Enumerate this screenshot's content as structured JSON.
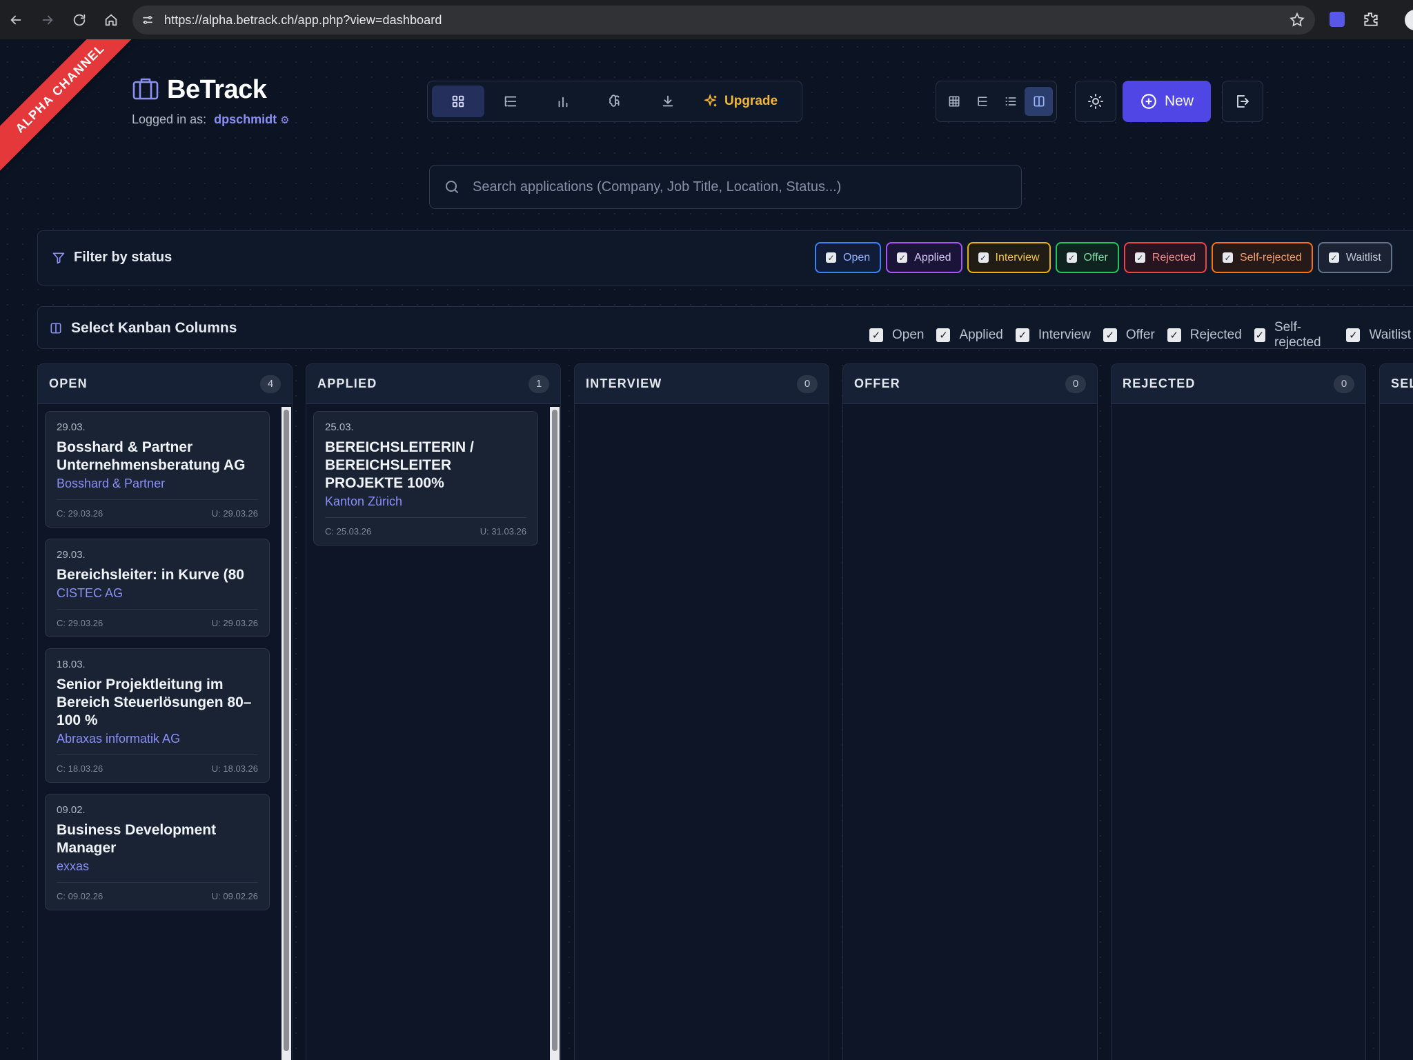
{
  "browser": {
    "url": "https://alpha.betrack.ch/app.php?view=dashboard"
  },
  "app": {
    "ribbon": "ALPHA CHANNEL",
    "title": "BeTrack",
    "logged_in_label": "Logged in as:",
    "username": "dpschmidt",
    "upgrade_label": "Upgrade",
    "new_label": "New",
    "search_placeholder": "Search applications (Company, Job Title, Location, Status...)"
  },
  "filter": {
    "title": "Filter by status",
    "chips": [
      {
        "label": "Open",
        "color": "#3b82f6",
        "text_color": "#93b4ff",
        "bg": "#101c38"
      },
      {
        "label": "Applied",
        "color": "#a855f7",
        "text_color": "#d5c8f5",
        "bg": "#1a1438"
      },
      {
        "label": "Interview",
        "color": "#eab308",
        "text_color": "#f3c640",
        "bg": "#221d14"
      },
      {
        "label": "Offer",
        "color": "#22c55e",
        "text_color": "#7fd9a0",
        "bg": "#0f2320"
      },
      {
        "label": "Rejected",
        "color": "#ef4444",
        "text_color": "#f28a8a",
        "bg": "#261420"
      },
      {
        "label": "Self-rejected",
        "color": "#f97316",
        "text_color": "#f59e6b",
        "bg": "#261a18"
      },
      {
        "label": "Waitlist",
        "color": "#64748b",
        "text_color": "#c2c9d4",
        "bg": "#1a2233"
      }
    ]
  },
  "kanban_select": {
    "title": "Select Kanban Columns",
    "options": [
      "Open",
      "Applied",
      "Interview",
      "Offer",
      "Rejected",
      "Self-rejected",
      "Waitlist"
    ]
  },
  "columns": [
    {
      "title": "OPEN",
      "count": "4",
      "cards": [
        {
          "date": "29.03.",
          "title": "Bosshard & Partner Unternehmensberatung AG",
          "company": "Bosshard & Partner",
          "created": "C: 29.03.26",
          "updated": "U: 29.03.26"
        },
        {
          "date": "29.03.",
          "title": "Bereichsleiter: in Kurve (80",
          "company": "CISTEC AG",
          "created": "C: 29.03.26",
          "updated": "U: 29.03.26"
        },
        {
          "date": "18.03.",
          "title": "Senior Projektleitung im Bereich Steuerlösungen 80–100 %",
          "company": "Abraxas informatik AG",
          "created": "C: 18.03.26",
          "updated": "U: 18.03.26"
        },
        {
          "date": "09.02.",
          "title": "Business Development Manager",
          "company": "exxas",
          "created": "C: 09.02.26",
          "updated": "U: 09.02.26"
        }
      ]
    },
    {
      "title": "APPLIED",
      "count": "1",
      "cards": [
        {
          "date": "25.03.",
          "title": "BEREICHSLEITERIN / BEREICHSLEITER PROJEKTE 100%",
          "company": "Kanton Zürich",
          "created": "C: 25.03.26",
          "updated": "U: 31.03.26"
        }
      ]
    },
    {
      "title": "INTERVIEW",
      "count": "0",
      "cards": []
    },
    {
      "title": "OFFER",
      "count": "0",
      "cards": []
    },
    {
      "title": "REJECTED",
      "count": "0",
      "cards": []
    },
    {
      "title": "SEL",
      "count": "",
      "cards": []
    }
  ]
}
